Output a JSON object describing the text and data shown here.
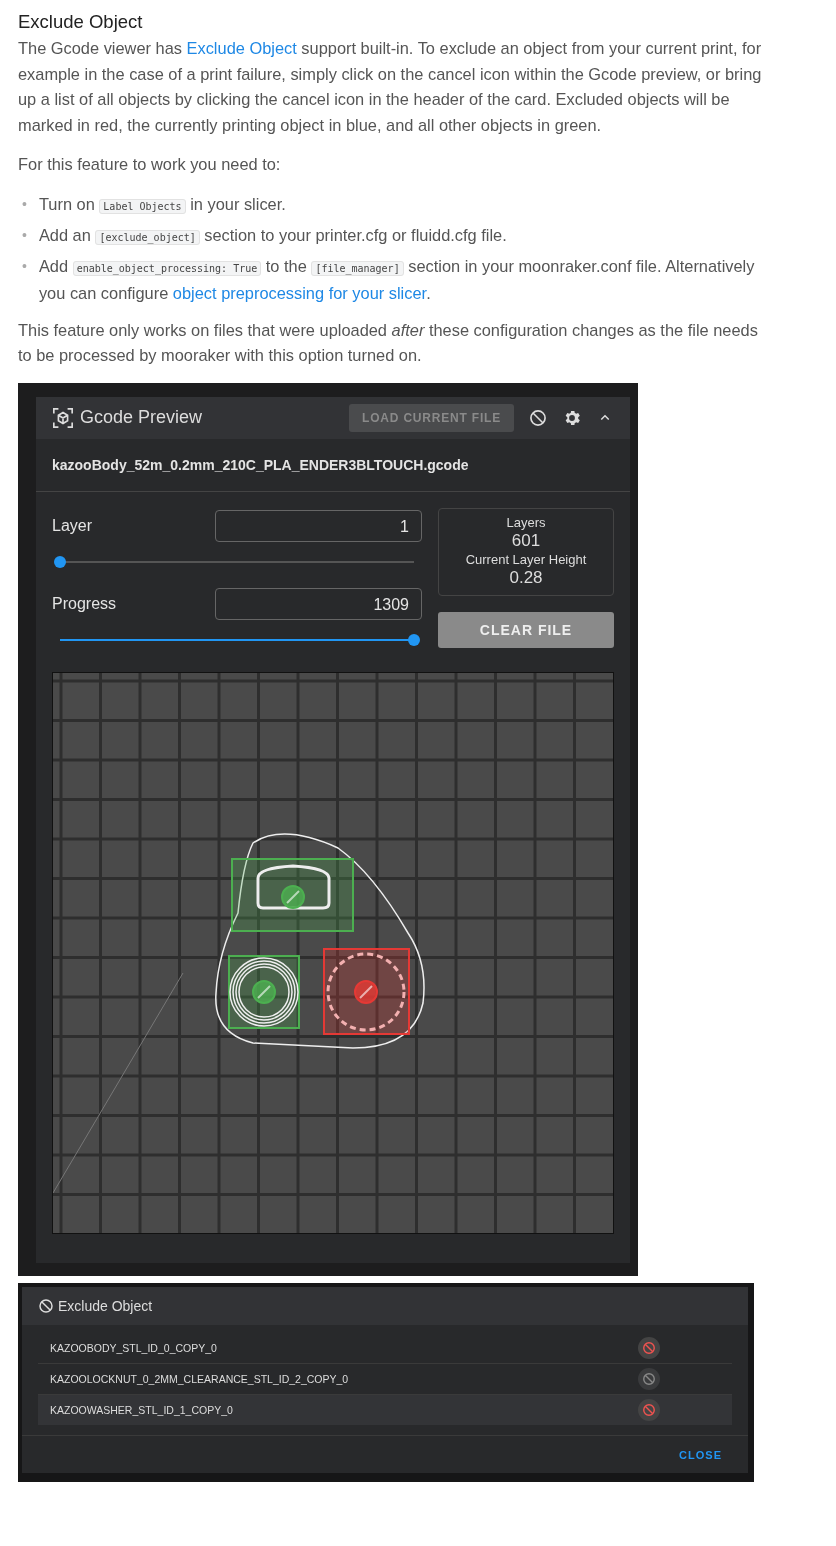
{
  "heading": "Exclude Object",
  "intro": {
    "before": "The Gcode viewer has ",
    "link": "Exclude Object",
    "after": " support built-in. To exclude an object from your current print, for example in the case of a print failure, simply click on the cancel icon within the Gcode preview, or bring up a list of all objects by clicking the cancel icon in the header of the card. Excluded objects will be marked in red, the currently printing object in blue, and all other objects in green."
  },
  "requirements_lead": "For this feature to work you need to:",
  "steps": [
    {
      "marker": "•",
      "parts": [
        {
          "kind": "text",
          "text": "Turn on "
        },
        {
          "kind": "code",
          "text": "Label Objects"
        },
        {
          "kind": "text",
          "text": " in your slicer."
        }
      ]
    },
    {
      "marker": "•",
      "parts": [
        {
          "kind": "text",
          "text": "Add an "
        },
        {
          "kind": "code",
          "text": "[exclude_object]"
        },
        {
          "kind": "text",
          "text": " section to your printer.cfg or fluidd.cfg file."
        }
      ]
    },
    {
      "marker": "•",
      "parts": [
        {
          "kind": "text",
          "text": "Add "
        },
        {
          "kind": "code",
          "text": "enable_object_processing: True"
        },
        {
          "kind": "text",
          "text": " to the "
        },
        {
          "kind": "code",
          "text": "[file_manager]"
        },
        {
          "kind": "text",
          "text": " section in your moonraker.conf file. Alternatively you can configure "
        },
        {
          "kind": "link",
          "text": "object preprocessing for your slicer"
        },
        {
          "kind": "text",
          "text": "."
        }
      ]
    }
  ],
  "note": "This feature only works on files that were uploaded *after* these configuration changes as the file needs to be processed by mooraker with this option turned on.",
  "preview": {
    "title": "Gcode Preview",
    "load_button": "LOAD CURRENT FILE",
    "filename": "kazooBody_52m_0.2mm_210C_PLA_ENDER3BLTOUCH.gcode",
    "layer": {
      "label": "Layer",
      "value": "1",
      "level": 0
    },
    "progress": {
      "label": "Progress",
      "value": "1309",
      "level": 1
    },
    "stats": [
      {
        "label": "Layers",
        "value": "601"
      },
      {
        "label": "Current Layer Height",
        "value": "0.28"
      }
    ],
    "clear_button": "CLEAR FILE",
    "objects": [
      {
        "color": "#4caf50"
      },
      {
        "color": "#4caf50"
      },
      {
        "color": "#e53935"
      }
    ]
  },
  "dialog": {
    "title": "Exclude Object",
    "rows": [
      {
        "name": "KAZOOBODY_STL_ID_0_COPY_0",
        "disabled": false,
        "selected": false
      },
      {
        "name": "KAZOOLOCKNUT_0_2MM_CLEARANCE_STL_ID_2_COPY_0",
        "disabled": true,
        "selected": false
      },
      {
        "name": "KAZOOWASHER_STL_ID_1_COPY_0",
        "disabled": false,
        "selected": true
      }
    ],
    "close_button": "CLOSE"
  }
}
